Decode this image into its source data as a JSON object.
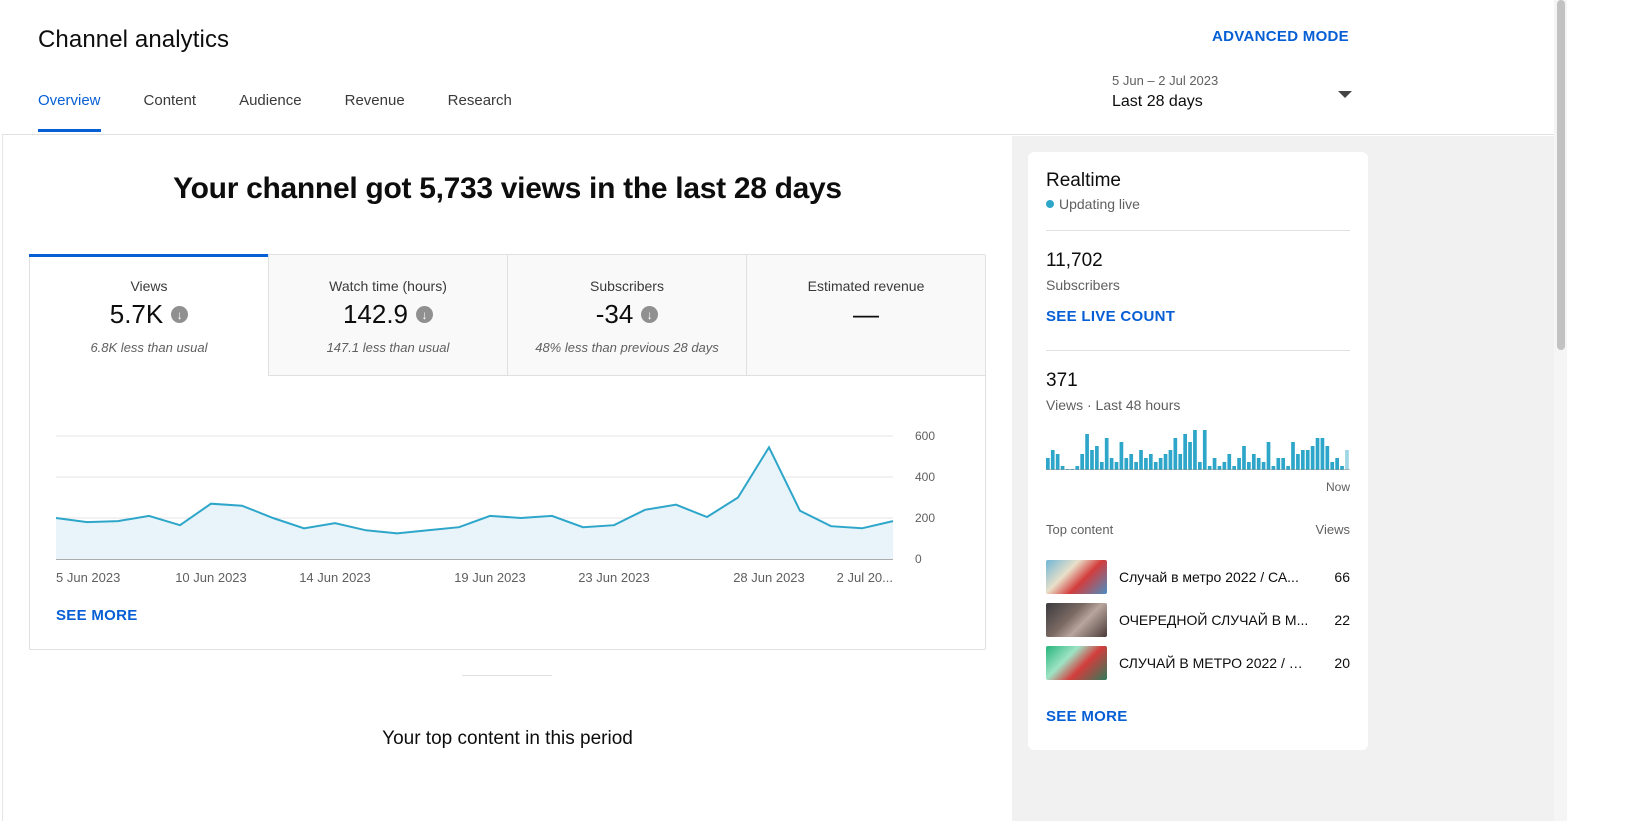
{
  "header": {
    "title": "Channel analytics",
    "advanced_mode": "ADVANCED MODE",
    "tabs": [
      {
        "label": "Overview",
        "active": true
      },
      {
        "label": "Content",
        "active": false
      },
      {
        "label": "Audience",
        "active": false
      },
      {
        "label": "Revenue",
        "active": false
      },
      {
        "label": "Research",
        "active": false
      }
    ],
    "date_range": "5 Jun – 2 Jul 2023",
    "date_label": "Last 28 days",
    "accent_color": "#065fd4"
  },
  "main": {
    "headline": "Your channel got 5,733 views in the last 28 days",
    "metrics": [
      {
        "name": "Views",
        "value": "5.7K",
        "trend": "down",
        "note": "6.8K less than usual"
      },
      {
        "name": "Watch time (hours)",
        "value": "142.9",
        "trend": "down",
        "note": "147.1 less than usual"
      },
      {
        "name": "Subscribers",
        "value": "-34",
        "trend": "down",
        "note": "48% less than previous 28 days"
      },
      {
        "name": "Estimated revenue",
        "value": "—",
        "trend": "",
        "note": ""
      }
    ],
    "see_more": "SEE MORE",
    "top_content_heading": "Your top content in this period"
  },
  "chart_data": {
    "type": "area",
    "title": "",
    "xlabel": "",
    "ylabel": "",
    "x": [
      "5 Jun",
      "6 Jun",
      "7 Jun",
      "8 Jun",
      "9 Jun",
      "10 Jun",
      "11 Jun",
      "12 Jun",
      "13 Jun",
      "14 Jun",
      "15 Jun",
      "16 Jun",
      "17 Jun",
      "18 Jun",
      "19 Jun",
      "20 Jun",
      "21 Jun",
      "22 Jun",
      "23 Jun",
      "24 Jun",
      "25 Jun",
      "26 Jun",
      "27 Jun",
      "28 Jun",
      "29 Jun",
      "30 Jun",
      "1 Jul",
      "2 Jul"
    ],
    "series": [
      {
        "values": [
          200,
          180,
          185,
          210,
          165,
          270,
          260,
          200,
          150,
          175,
          140,
          125,
          140,
          155,
          210,
          200,
          210,
          155,
          165,
          240,
          265,
          205,
          300,
          545,
          235,
          160,
          150,
          185
        ],
        "color": "#2ea6c9"
      }
    ],
    "x_tick_labels": [
      "5 Jun 2023",
      "10 Jun 2023",
      "14 Jun 2023",
      "19 Jun 2023",
      "23 Jun 2023",
      "28 Jun 2023",
      "2 Jul 20..."
    ],
    "x_tick_index": [
      0,
      5,
      9,
      14,
      18,
      23,
      27
    ],
    "y_ticks": [
      0,
      200,
      400,
      600
    ],
    "ylim": [
      0,
      600
    ],
    "grid": true,
    "y_axis_side": "right"
  },
  "realtime": {
    "title": "Realtime",
    "live_text": "Updating live",
    "subscribers_value": "11,702",
    "subscribers_label": "Subscribers",
    "see_live_count": "SEE LIVE COUNT",
    "views_value": "371",
    "views_label": "Views · Last 48 hours",
    "bars": [
      3,
      5,
      4,
      1,
      0,
      0,
      1,
      4,
      9,
      5,
      6,
      2,
      8,
      3,
      2,
      7,
      3,
      4,
      2,
      5,
      3,
      4,
      2,
      3,
      4,
      5,
      8,
      4,
      9,
      7,
      10,
      2,
      10,
      1,
      3,
      1,
      2,
      4,
      1,
      3,
      6,
      2,
      4,
      3,
      2,
      7,
      1,
      3,
      3,
      1,
      7,
      4,
      5,
      5,
      6,
      8,
      8,
      6,
      2,
      3,
      1,
      5
    ],
    "now_label": "Now",
    "top_content_label": "Top content",
    "views_column": "Views",
    "items": [
      {
        "title": "Случай в метро 2022 / СА...",
        "views": "66"
      },
      {
        "title": "ОЧЕРЕДНОЙ СЛУЧАЙ В М...",
        "views": "22"
      },
      {
        "title": "СЛУЧАЙ В МЕТРО 2022 / Л...",
        "views": "20"
      }
    ],
    "see_more": "SEE MORE"
  }
}
